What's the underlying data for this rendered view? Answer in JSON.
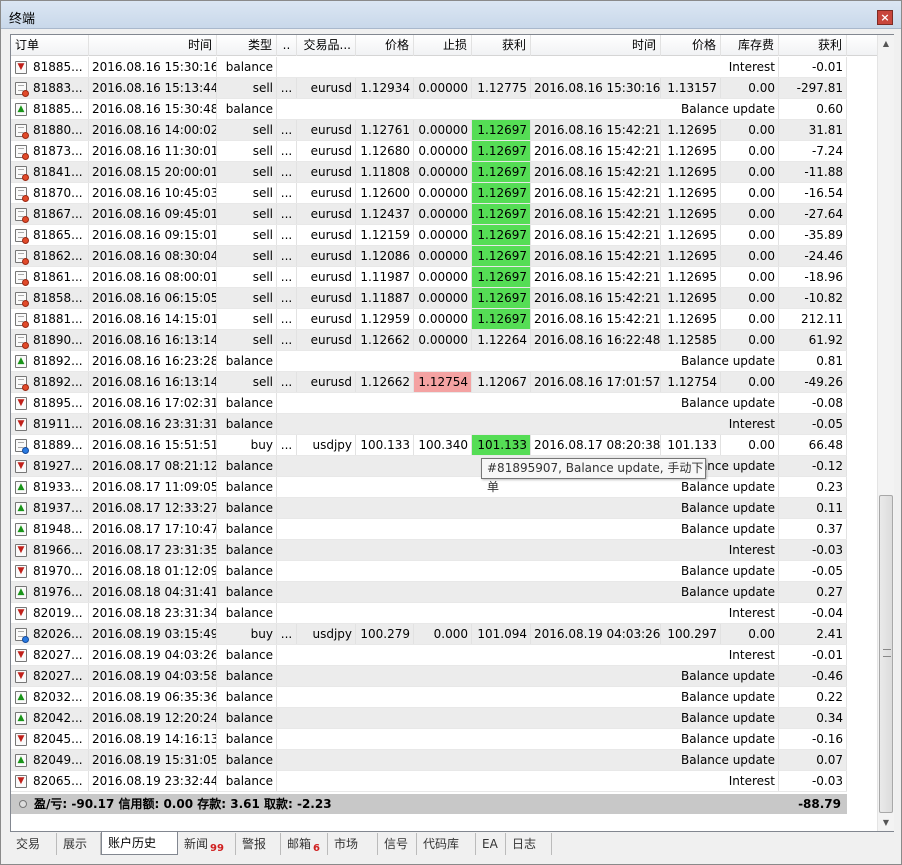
{
  "window": {
    "title": "终端",
    "close_label": "×"
  },
  "columns": [
    {
      "label": "订单",
      "key": "order"
    },
    {
      "label": "时间",
      "key": "open_time"
    },
    {
      "label": "类型",
      "key": "type"
    },
    {
      "label": "..",
      "key": "size"
    },
    {
      "label": "交易品...",
      "key": "symbol"
    },
    {
      "label": "价格",
      "key": "price"
    },
    {
      "label": "止损",
      "key": "sl"
    },
    {
      "label": "获利",
      "key": "tp"
    },
    {
      "label": "时间",
      "key": "close_time",
      "sort_indicator": "/"
    },
    {
      "label": "价格",
      "key": "close_price"
    },
    {
      "label": "库存费",
      "key": "swap"
    },
    {
      "label": "获利",
      "key": "profit"
    }
  ],
  "rows": [
    {
      "icon": "down",
      "order": "81885...",
      "open_time": "2016.08.16 15:30:16",
      "type": "balance",
      "comment": "Interest",
      "profit": "-0.01"
    },
    {
      "icon": "sell",
      "order": "81883...",
      "open_time": "2016.08.16 15:13:44",
      "type": "sell",
      "size": "...",
      "symbol": "eurusd",
      "price": "1.12934",
      "sl": "0.00000",
      "tp": "1.12775",
      "close_time": "2016.08.16 15:30:16",
      "close_price": "1.13157",
      "swap": "0.00",
      "profit": "-297.81"
    },
    {
      "icon": "up",
      "order": "81885...",
      "open_time": "2016.08.16 15:30:48",
      "type": "balance",
      "comment": "Balance update",
      "profit": "0.60"
    },
    {
      "icon": "sell",
      "order": "81880...",
      "open_time": "2016.08.16 14:00:02",
      "type": "sell",
      "size": "...",
      "symbol": "eurusd",
      "price": "1.12761",
      "sl": "0.00000",
      "tp": "1.12697",
      "tp_hl": "g",
      "close_time": "2016.08.16 15:42:21",
      "close_price": "1.12695",
      "swap": "0.00",
      "profit": "31.81"
    },
    {
      "icon": "sell",
      "order": "81873...",
      "open_time": "2016.08.16 11:30:01",
      "type": "sell",
      "size": "...",
      "symbol": "eurusd",
      "price": "1.12680",
      "sl": "0.00000",
      "tp": "1.12697",
      "tp_hl": "g",
      "close_time": "2016.08.16 15:42:21",
      "close_price": "1.12695",
      "swap": "0.00",
      "profit": "-7.24"
    },
    {
      "icon": "sell",
      "order": "81841...",
      "open_time": "2016.08.15 20:00:01",
      "type": "sell",
      "size": "...",
      "symbol": "eurusd",
      "price": "1.11808",
      "sl": "0.00000",
      "tp": "1.12697",
      "tp_hl": "g",
      "close_time": "2016.08.16 15:42:21",
      "close_price": "1.12695",
      "swap": "0.00",
      "profit": "-11.88"
    },
    {
      "icon": "sell",
      "order": "81870...",
      "open_time": "2016.08.16 10:45:03",
      "type": "sell",
      "size": "...",
      "symbol": "eurusd",
      "price": "1.12600",
      "sl": "0.00000",
      "tp": "1.12697",
      "tp_hl": "g",
      "close_time": "2016.08.16 15:42:21",
      "close_price": "1.12695",
      "swap": "0.00",
      "profit": "-16.54"
    },
    {
      "icon": "sell",
      "order": "81867...",
      "open_time": "2016.08.16 09:45:01",
      "type": "sell",
      "size": "...",
      "symbol": "eurusd",
      "price": "1.12437",
      "sl": "0.00000",
      "tp": "1.12697",
      "tp_hl": "g",
      "close_time": "2016.08.16 15:42:21",
      "close_price": "1.12695",
      "swap": "0.00",
      "profit": "-27.64"
    },
    {
      "icon": "sell",
      "order": "81865...",
      "open_time": "2016.08.16 09:15:01",
      "type": "sell",
      "size": "...",
      "symbol": "eurusd",
      "price": "1.12159",
      "sl": "0.00000",
      "tp": "1.12697",
      "tp_hl": "g",
      "close_time": "2016.08.16 15:42:21",
      "close_price": "1.12695",
      "swap": "0.00",
      "profit": "-35.89"
    },
    {
      "icon": "sell",
      "order": "81862...",
      "open_time": "2016.08.16 08:30:04",
      "type": "sell",
      "size": "...",
      "symbol": "eurusd",
      "price": "1.12086",
      "sl": "0.00000",
      "tp": "1.12697",
      "tp_hl": "g",
      "close_time": "2016.08.16 15:42:21",
      "close_price": "1.12695",
      "swap": "0.00",
      "profit": "-24.46"
    },
    {
      "icon": "sell",
      "order": "81861...",
      "open_time": "2016.08.16 08:00:01",
      "type": "sell",
      "size": "...",
      "symbol": "eurusd",
      "price": "1.11987",
      "sl": "0.00000",
      "tp": "1.12697",
      "tp_hl": "g",
      "close_time": "2016.08.16 15:42:21",
      "close_price": "1.12695",
      "swap": "0.00",
      "profit": "-18.96"
    },
    {
      "icon": "sell",
      "order": "81858...",
      "open_time": "2016.08.16 06:15:05",
      "type": "sell",
      "size": "...",
      "symbol": "eurusd",
      "price": "1.11887",
      "sl": "0.00000",
      "tp": "1.12697",
      "tp_hl": "g",
      "close_time": "2016.08.16 15:42:21",
      "close_price": "1.12695",
      "swap": "0.00",
      "profit": "-10.82"
    },
    {
      "icon": "sell",
      "order": "81881...",
      "open_time": "2016.08.16 14:15:01",
      "type": "sell",
      "size": "...",
      "symbol": "eurusd",
      "price": "1.12959",
      "sl": "0.00000",
      "tp": "1.12697",
      "tp_hl": "g",
      "close_time": "2016.08.16 15:42:21",
      "close_price": "1.12695",
      "swap": "0.00",
      "profit": "212.11"
    },
    {
      "icon": "sell",
      "order": "81890...",
      "open_time": "2016.08.16 16:13:14",
      "type": "sell",
      "size": "...",
      "symbol": "eurusd",
      "price": "1.12662",
      "sl": "0.00000",
      "tp": "1.12264",
      "close_time": "2016.08.16 16:22:48",
      "close_price": "1.12585",
      "swap": "0.00",
      "profit": "61.92"
    },
    {
      "icon": "up",
      "order": "81892...",
      "open_time": "2016.08.16 16:23:28",
      "type": "balance",
      "comment": "Balance update",
      "profit": "0.81"
    },
    {
      "icon": "sell",
      "order": "81892...",
      "open_time": "2016.08.16 16:13:14",
      "type": "sell",
      "size": "...",
      "symbol": "eurusd",
      "price": "1.12662",
      "sl": "1.12754",
      "sl_hl": "r",
      "tp": "1.12067",
      "close_time": "2016.08.16 17:01:57",
      "close_price": "1.12754",
      "swap": "0.00",
      "profit": "-49.26"
    },
    {
      "icon": "down",
      "order": "81895...",
      "open_time": "2016.08.16 17:02:31",
      "type": "balance",
      "comment": "Balance update",
      "profit": "-0.08"
    },
    {
      "icon": "down",
      "order": "81911...",
      "open_time": "2016.08.16 23:31:31",
      "type": "balance",
      "comment": "Interest",
      "profit": "-0.05"
    },
    {
      "icon": "buy",
      "order": "81889...",
      "open_time": "2016.08.16 15:51:51",
      "type": "buy",
      "size": "...",
      "symbol": "usdjpy",
      "price": "100.133",
      "sl": "100.340",
      "tp": "101.133",
      "tp_hl": "g",
      "close_time": "2016.08.17 08:20:38",
      "close_price": "101.133",
      "swap": "0.00",
      "profit": "66.48"
    },
    {
      "icon": "down",
      "order": "81927...",
      "open_time": "2016.08.17 08:21:12",
      "type": "balance",
      "comment": "Balance update",
      "profit": "-0.12"
    },
    {
      "icon": "up",
      "order": "81933...",
      "open_time": "2016.08.17 11:09:05",
      "type": "balance",
      "comment": "Balance update",
      "profit": "0.23"
    },
    {
      "icon": "up",
      "order": "81937...",
      "open_time": "2016.08.17 12:33:27",
      "type": "balance",
      "comment": "Balance update",
      "profit": "0.11"
    },
    {
      "icon": "up",
      "order": "81948...",
      "open_time": "2016.08.17 17:10:47",
      "type": "balance",
      "comment": "Balance update",
      "profit": "0.37"
    },
    {
      "icon": "down",
      "order": "81966...",
      "open_time": "2016.08.17 23:31:35",
      "type": "balance",
      "comment": "Interest",
      "profit": "-0.03"
    },
    {
      "icon": "down",
      "order": "81970...",
      "open_time": "2016.08.18 01:12:09",
      "type": "balance",
      "comment": "Balance update",
      "profit": "-0.05"
    },
    {
      "icon": "up",
      "order": "81976...",
      "open_time": "2016.08.18 04:31:41",
      "type": "balance",
      "comment": "Balance update",
      "profit": "0.27"
    },
    {
      "icon": "down",
      "order": "82019...",
      "open_time": "2016.08.18 23:31:34",
      "type": "balance",
      "comment": "Interest",
      "profit": "-0.04"
    },
    {
      "icon": "buy",
      "order": "82026...",
      "open_time": "2016.08.19 03:15:49",
      "type": "buy",
      "size": "...",
      "symbol": "usdjpy",
      "price": "100.279",
      "sl": "0.000",
      "tp": "101.094",
      "close_time": "2016.08.19 04:03:26",
      "close_price": "100.297",
      "swap": "0.00",
      "profit": "2.41"
    },
    {
      "icon": "down",
      "order": "82027...",
      "open_time": "2016.08.19 04:03:26",
      "type": "balance",
      "comment": "Interest",
      "profit": "-0.01"
    },
    {
      "icon": "down",
      "order": "82027...",
      "open_time": "2016.08.19 04:03:58",
      "type": "balance",
      "comment": "Balance update",
      "profit": "-0.46"
    },
    {
      "icon": "up",
      "order": "82032...",
      "open_time": "2016.08.19 06:35:36",
      "type": "balance",
      "comment": "Balance update",
      "profit": "0.22"
    },
    {
      "icon": "up",
      "order": "82042...",
      "open_time": "2016.08.19 12:20:24",
      "type": "balance",
      "comment": "Balance update",
      "profit": "0.34"
    },
    {
      "icon": "down",
      "order": "82045...",
      "open_time": "2016.08.19 14:16:13",
      "type": "balance",
      "comment": "Balance update",
      "profit": "-0.16"
    },
    {
      "icon": "up",
      "order": "82049...",
      "open_time": "2016.08.19 15:31:05",
      "type": "balance",
      "comment": "Balance update",
      "profit": "0.07"
    },
    {
      "icon": "down",
      "order": "82065...",
      "open_time": "2016.08.19 23:32:44",
      "type": "balance",
      "comment": "Interest",
      "profit": "-0.03"
    }
  ],
  "summary": {
    "text": "盈/亏: -90.17  信用额: 0.00  存款: 3.61  取款: -2.23",
    "total": "-88.79"
  },
  "tooltip": {
    "text": "#81895907, Balance update, 手动下单"
  },
  "tabs": [
    {
      "label": "交易"
    },
    {
      "label": "展示"
    },
    {
      "label": "账户历史",
      "active": true
    },
    {
      "label": "新闻",
      "badge": "99"
    },
    {
      "label": "警报"
    },
    {
      "label": "邮箱",
      "badge": "6"
    },
    {
      "label": "市场"
    },
    {
      "label": "信号"
    },
    {
      "label": "代码库"
    },
    {
      "label": "EA"
    },
    {
      "label": "日志"
    }
  ],
  "colors": {
    "tp_hit": "#55dd55",
    "sl_hit": "#f4a2a2",
    "summary_bg": "#c8c8c8"
  },
  "icons": {
    "down": "arrow-down-red-icon",
    "up": "arrow-up-green-icon",
    "sell": "sell-order-icon",
    "buy": "buy-order-icon"
  }
}
